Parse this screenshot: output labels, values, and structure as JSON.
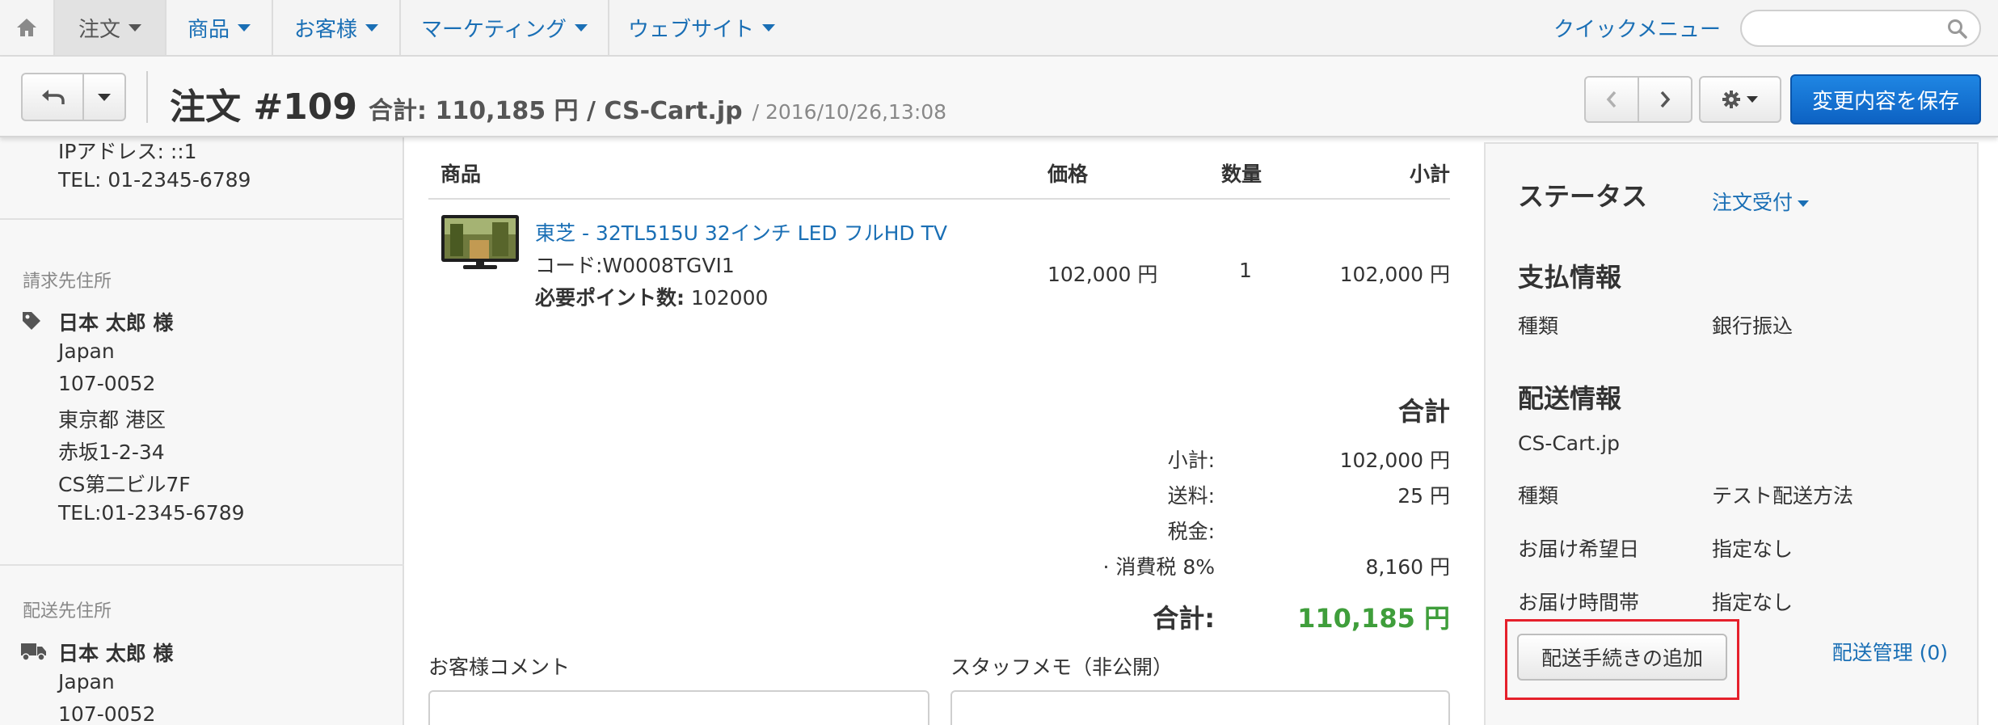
{
  "navbar": {
    "items": [
      {
        "label": "注文"
      },
      {
        "label": "商品"
      },
      {
        "label": "お客様"
      },
      {
        "label": "マーケティング"
      },
      {
        "label": "ウェブサイト"
      }
    ],
    "quick_menu": "クイックメニュー",
    "search_placeholder": ""
  },
  "actionbar": {
    "title": "注文 #109",
    "summary": "合計: 110,185 円 / CS-Cart.jp",
    "date": "/ 2016/10/26,13:08",
    "save_label": "変更内容を保存"
  },
  "left_sidebar": {
    "ip": "IPアドレス: ::1",
    "tel": "TEL: 01-2345-6789",
    "billing": {
      "heading": "請求先住所",
      "name": "日本 太郎 様",
      "lines": [
        "Japan",
        "107-0052",
        "東京都 港区",
        "赤坂1-2-34",
        "CS第二ビル7F",
        "TEL:01-2345-6789"
      ]
    },
    "shipping": {
      "heading": "配送先住所",
      "name": "日本 太郎 様",
      "lines": [
        "Japan",
        "107-0052"
      ]
    }
  },
  "products": {
    "headers": {
      "product": "商品",
      "price": "価格",
      "quantity": "数量",
      "subtotal": "小計"
    },
    "items": [
      {
        "name": "東芝 - 32TL515U 32インチ LED フルHD TV",
        "code": "コード:W0008TGVI1",
        "points_label": "必要ポイント数:",
        "points_value": " 102000",
        "price": "102,000 円",
        "quantity": "1",
        "subtotal": "102,000 円"
      }
    ]
  },
  "totals": {
    "heading": "合計",
    "rows": [
      {
        "label": "小計:",
        "value": "102,000 円"
      },
      {
        "label": "送料:",
        "value": "25 円"
      },
      {
        "label": "税金:",
        "value": ""
      },
      {
        "label": "· 消費税 8%",
        "value": "8,160 円"
      }
    ],
    "grand_label": "合計:",
    "grand_value": "110,185 円",
    "grand_color": "#3f9e3b"
  },
  "comments": {
    "customer_label": "お客様コメント",
    "staff_label": "スタッフメモ（非公開）"
  },
  "right_sidebar": {
    "status_heading": "ステータス",
    "status_value": "注文受付",
    "payment_heading": "支払情報",
    "payment_rows": [
      {
        "label": "種類",
        "value": "銀行振込"
      }
    ],
    "shipping_heading": "配送情報",
    "carrier": "CS-Cart.jp",
    "shipping_rows": [
      {
        "label": "種類",
        "value": "テスト配送方法"
      },
      {
        "label": "お届け希望日",
        "value": "指定なし"
      },
      {
        "label": "お届け時間帯",
        "value": "指定なし"
      }
    ],
    "add_shipment_label": "配送手続きの追加",
    "shipment_mgmt_label": "配送管理 (0)",
    "highlight_color": "#e5202b"
  },
  "colors": {
    "link": "#1a6fb5",
    "primary_button": "#1577d4",
    "total_green": "#3f9e3b"
  },
  "icons": [
    "home-icon",
    "undo-icon",
    "chevron-left-icon",
    "chevron-right-icon",
    "gear-icon",
    "search-icon",
    "tag-icon",
    "truck-icon"
  ]
}
